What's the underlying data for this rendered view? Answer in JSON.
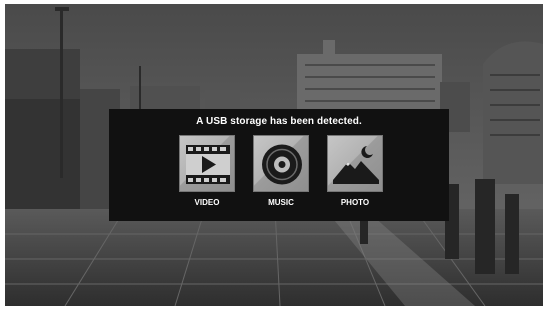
{
  "dialog": {
    "title": "A USB storage has been detected.",
    "options": [
      {
        "label": "VIDEO",
        "icon": "film-play-icon"
      },
      {
        "label": "MUSIC",
        "icon": "disc-icon"
      },
      {
        "label": "PHOTO",
        "icon": "mountain-moon-icon"
      }
    ]
  },
  "colors": {
    "dialog_bg": "#111111",
    "tile_light": "#c6c6c6",
    "tile_dark": "#8f8f8f",
    "icon_dark": "#1a1a1a",
    "text": "#ffffff"
  }
}
